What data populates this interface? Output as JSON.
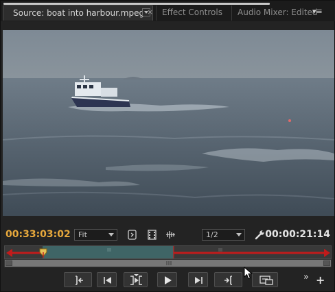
{
  "tabs": {
    "source": "Source: boat into harbour.mpeg",
    "close": "×",
    "effect_controls": "Effect Controls",
    "audio_mixer": "Audio Mixer: Edited",
    "menu": "▾≡"
  },
  "controls": {
    "current_timecode": "00:33:03:02",
    "zoom_select": "Fit",
    "resolution_select": "1/2",
    "duration_timecode": "00:00:21:14"
  },
  "transport": {
    "more": "»",
    "add": "+"
  },
  "colors": {
    "accent_timecode": "#e8a93c",
    "in_out_range": "#3f6566",
    "range_line": "#c21b1b"
  },
  "icons": [
    "wrench-icon",
    "output-icon",
    "filmstrip-icon",
    "audio-waveform-icon",
    "mark-in-icon",
    "step-back-icon",
    "play-in-out-icon",
    "play-icon",
    "step-forward-icon",
    "mark-out-icon",
    "export-frame-icon"
  ]
}
